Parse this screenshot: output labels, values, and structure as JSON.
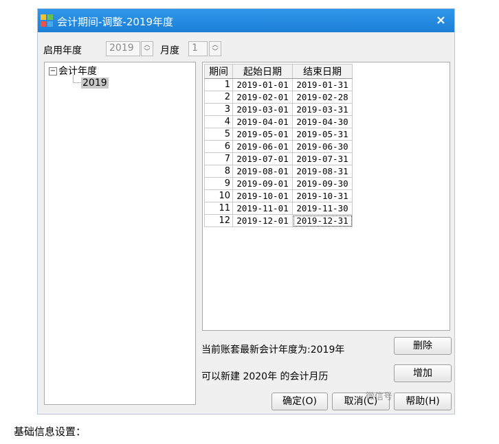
{
  "window": {
    "title": "会计期间-调整-2019年度",
    "close_glyph": "×"
  },
  "controls": {
    "start_year_label": "启用年度",
    "start_year_value": "2019",
    "month_label": "月度",
    "month_value": "1"
  },
  "tree": {
    "root": "会计年度",
    "root_toggle": "−",
    "child": "2019"
  },
  "table": {
    "headers": [
      "期间",
      "起始日期",
      "结束日期"
    ],
    "rows": [
      [
        "1",
        "2019-01-01",
        "2019-01-31"
      ],
      [
        "2",
        "2019-02-01",
        "2019-02-28"
      ],
      [
        "3",
        "2019-03-01",
        "2019-03-31"
      ],
      [
        "4",
        "2019-04-01",
        "2019-04-30"
      ],
      [
        "5",
        "2019-05-01",
        "2019-05-31"
      ],
      [
        "6",
        "2019-06-01",
        "2019-06-30"
      ],
      [
        "7",
        "2019-07-01",
        "2019-07-31"
      ],
      [
        "8",
        "2019-08-01",
        "2019-08-31"
      ],
      [
        "9",
        "2019-09-01",
        "2019-09-30"
      ],
      [
        "10",
        "2019-10-01",
        "2019-10-31"
      ],
      [
        "11",
        "2019-11-01",
        "2019-11-30"
      ],
      [
        "12",
        "2019-12-01",
        "2019-12-31"
      ]
    ]
  },
  "info": {
    "latest_year": "当前账套最新会计年度为:2019年",
    "can_create": "可以新建 2020年 的会计月历"
  },
  "buttons": {
    "delete": "删除",
    "add": "增加",
    "ok": "确定(O)",
    "cancel": "取消(C)",
    "help": "帮助(H)"
  },
  "caption": "基础信息设置：",
  "watermark": "微信号"
}
